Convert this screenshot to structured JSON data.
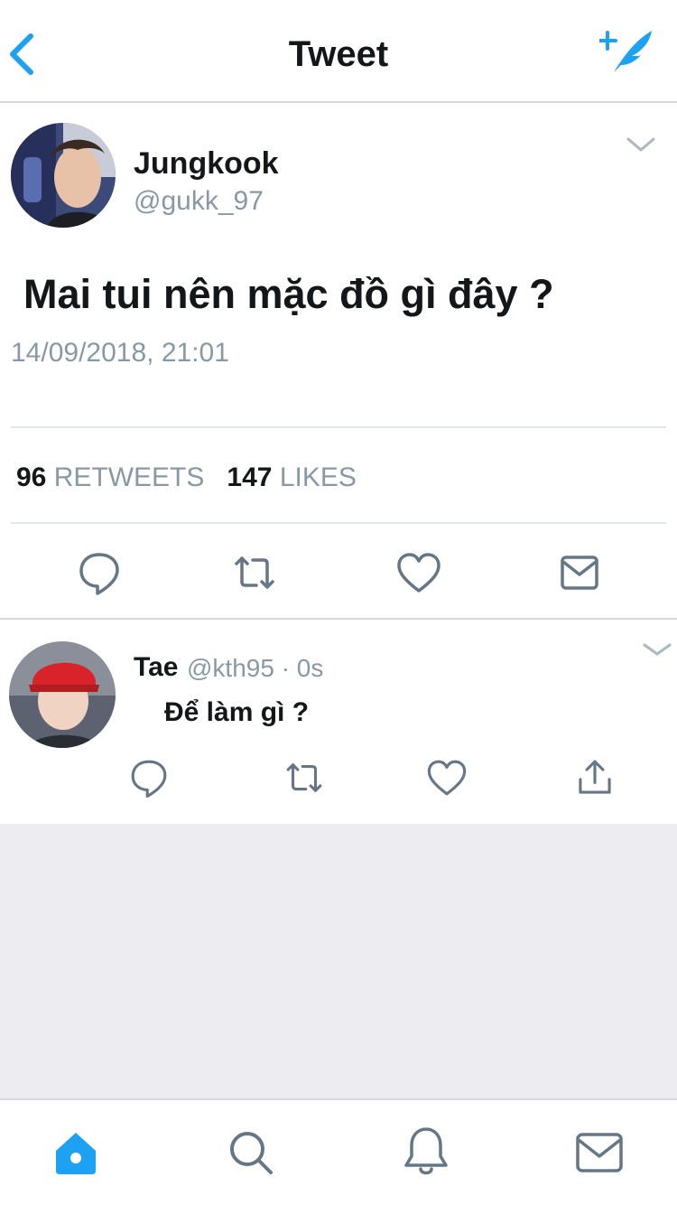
{
  "header": {
    "title": "Tweet",
    "back_icon": "chevron-left-icon",
    "compose_icon": "compose-tweet-icon",
    "accent": "#1da1f2"
  },
  "tweet": {
    "author_name": "Jungkook",
    "author_handle": "@gukk_97",
    "text": "Mai tui nên mặc đồ gì đây ?",
    "timestamp": "14/09/2018, 21:01",
    "retweets_count": "96",
    "retweets_label": "RETWEETS",
    "likes_count": "147",
    "likes_label": "LIKES",
    "actions": [
      "reply-icon",
      "retweet-icon",
      "like-icon",
      "message-icon"
    ]
  },
  "reply": {
    "author_name": "Tae",
    "meta": "@kth95 · 0s",
    "text": "Để làm gì ?",
    "actions": [
      "reply-icon",
      "retweet-icon",
      "like-icon",
      "share-icon"
    ]
  },
  "tabbar": {
    "items": [
      "home-icon",
      "search-icon",
      "notifications-icon",
      "messages-icon"
    ],
    "active": "home-icon"
  }
}
